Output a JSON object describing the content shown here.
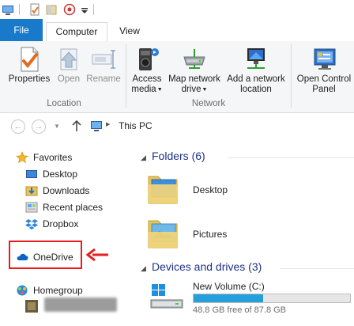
{
  "ribbon": {
    "tabs": [
      {
        "label": "File"
      },
      {
        "label": "Computer"
      },
      {
        "label": "View"
      }
    ],
    "location_group": {
      "label": "Location",
      "buttons": [
        {
          "label": "Properties",
          "icon": "properties-icon"
        },
        {
          "label": "Open",
          "icon": "open-icon"
        },
        {
          "label": "Rename",
          "icon": "rename-icon"
        }
      ]
    },
    "network_group": {
      "label": "Network",
      "buttons": [
        {
          "label1": "Access",
          "label2": "media",
          "icon": "access-media-icon"
        },
        {
          "label1": "Map network",
          "label2": "drive",
          "icon": "map-network-drive-icon"
        },
        {
          "label1": "Add a network",
          "label2": "location",
          "icon": "add-network-location-icon"
        }
      ]
    },
    "system_group": {
      "buttons": [
        {
          "label1": "Open Control",
          "label2": "Panel",
          "icon": "control-panel-icon"
        }
      ]
    }
  },
  "address_bar": {
    "path": "This PC"
  },
  "navigation": {
    "favorites": {
      "label": "Favorites",
      "items": [
        {
          "label": "Desktop"
        },
        {
          "label": "Downloads"
        },
        {
          "label": "Recent places"
        },
        {
          "label": "Dropbox"
        }
      ]
    },
    "onedrive": {
      "label": "OneDrive"
    },
    "homegroup": {
      "label": "Homegroup"
    }
  },
  "content": {
    "folders": {
      "heading": "Folders (6)",
      "items": [
        {
          "label": "Desktop"
        },
        {
          "label": "Pictures"
        }
      ]
    },
    "drives": {
      "heading": "Devices and drives (3)",
      "items": [
        {
          "name": "New Volume (C:)",
          "free_text": "48.8 GB free of 87.8 GB",
          "used_fraction": 0.444
        }
      ]
    }
  },
  "colors": {
    "file_tab": "#1979ca",
    "section_heading": "#1e3287",
    "highlight": "#e81c1c",
    "drive_bar": "#26a0da"
  }
}
